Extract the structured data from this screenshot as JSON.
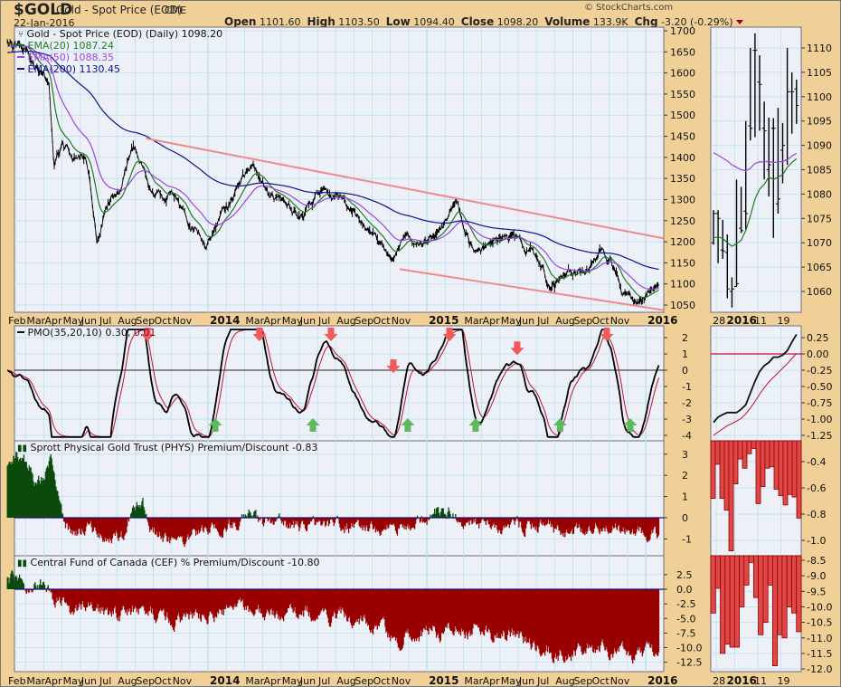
{
  "header": {
    "symbol": "$GOLD",
    "name": "Gold - Spot Price (EOD)",
    "exchange": "CME",
    "date": "22-Jan-2016",
    "copyright": "© StockCharts.com",
    "open_label": "Open",
    "open": "1101.60",
    "high_label": "High",
    "high": "1103.50",
    "low_label": "Low",
    "low": "1094.40",
    "close_label": "Close",
    "close": "1098.20",
    "volume_label": "Volume",
    "volume": "133.9K",
    "chg_label": "Chg",
    "chg": "-3.20 (-0.29%)"
  },
  "legends": {
    "price": "Gold - Spot Price (EOD) (Daily) 1098.20",
    "ema20": "EMA(20) 1087.24",
    "ema50": "EMA(50) 1088.35",
    "ema200": "EMA(200) 1130.45",
    "pmo_main": "PMO(35,20,10) 0.30,",
    "pmo_signal": "0.01",
    "phys": "Sprott Physical Gold Trust (PHYS) Premium/Discount -0.83",
    "cef": "Central Fund of Canada (CEF) % Premium/Discount -10.80"
  },
  "colors": {
    "background": "#f0d096",
    "panel": "#eef0f8",
    "grid": "#b9e2ee",
    "ema20": "#1f7a1f",
    "ema50": "#9b45e6",
    "ema200": "#10108c",
    "trendline": "#f08a8a",
    "pmo_signal": "#c0103a",
    "positive_bar": "#0b4a0b",
    "negative_bar": "#990000",
    "mini_bar": "#e04848",
    "arrow_down": "#f05a5a",
    "arrow_up": "#5cba5c"
  },
  "chart_data": [
    {
      "type": "line",
      "title": "Gold - Spot Price (EOD) (Daily)",
      "x_unit": "month index (Jan 2013 = 0)",
      "xlim": [
        0.95,
        36.75
      ],
      "ylim": [
        1040,
        1710
      ],
      "y_ticks": [
        1700,
        1650,
        1600,
        1550,
        1500,
        1450,
        1400,
        1350,
        1300,
        1250,
        1200,
        1150,
        1100,
        1050
      ],
      "price_keypoints": [
        [
          1.0,
          1670
        ],
        [
          2.0,
          1640
        ],
        [
          3.0,
          1600
        ],
        [
          3.3,
          1560
        ],
        [
          3.55,
          1380
        ],
        [
          4.0,
          1440
        ],
        [
          4.6,
          1400
        ],
        [
          5.3,
          1390
        ],
        [
          5.9,
          1200
        ],
        [
          6.5,
          1290
        ],
        [
          7.2,
          1330
        ],
        [
          7.9,
          1410
        ],
        [
          8.4,
          1390
        ],
        [
          8.8,
          1320
        ],
        [
          9.5,
          1300
        ],
        [
          10.3,
          1310
        ],
        [
          11.0,
          1250
        ],
        [
          11.9,
          1200
        ],
        [
          12.6,
          1250
        ],
        [
          13.5,
          1320
        ],
        [
          14.5,
          1380
        ],
        [
          15.3,
          1300
        ],
        [
          16.4,
          1295
        ],
        [
          17.2,
          1250
        ],
        [
          18.3,
          1330
        ],
        [
          19.3,
          1310
        ],
        [
          20.3,
          1250
        ],
        [
          21.1,
          1220
        ],
        [
          22.1,
          1150
        ],
        [
          22.8,
          1200
        ],
        [
          23.7,
          1195
        ],
        [
          24.5,
          1200
        ],
        [
          25.7,
          1295
        ],
        [
          26.6,
          1165
        ],
        [
          27.5,
          1200
        ],
        [
          28.7,
          1210
        ],
        [
          29.7,
          1175
        ],
        [
          30.4,
          1130
        ],
        [
          30.8,
          1090
        ],
        [
          31.6,
          1120
        ],
        [
          32.2,
          1130
        ],
        [
          33.0,
          1140
        ],
        [
          33.6,
          1180
        ],
        [
          34.1,
          1150
        ],
        [
          34.7,
          1080
        ],
        [
          35.6,
          1060
        ],
        [
          36.0,
          1065
        ],
        [
          36.72,
          1098.2
        ]
      ],
      "last_values": {
        "close": 1098.2,
        "ema20": 1087.24,
        "ema50": 1088.35,
        "ema200": 1130.45
      },
      "trendlines": [
        {
          "name": "upper",
          "from": [
            8.6,
            1445
          ],
          "to": [
            37.0,
            1208
          ]
        },
        {
          "name": "lower",
          "from": [
            22.5,
            1135
          ],
          "to": [
            37.0,
            1038
          ]
        }
      ],
      "x_labels": [
        {
          "m": 1,
          "label": "Feb"
        },
        {
          "m": 2,
          "label": "Mar"
        },
        {
          "m": 3,
          "label": "Apr"
        },
        {
          "m": 4,
          "label": "May"
        },
        {
          "m": 5,
          "label": "Jun"
        },
        {
          "m": 6,
          "label": "Jul"
        },
        {
          "m": 7,
          "label": "Aug"
        },
        {
          "m": 8,
          "label": "Sep"
        },
        {
          "m": 9,
          "label": "Oct"
        },
        {
          "m": 10,
          "label": "Nov"
        },
        {
          "m": 12,
          "label": "2014",
          "bold": true
        },
        {
          "m": 14,
          "label": "Mar"
        },
        {
          "m": 15,
          "label": "Apr"
        },
        {
          "m": 16,
          "label": "May"
        },
        {
          "m": 17,
          "label": "Jun"
        },
        {
          "m": 18,
          "label": "Jul"
        },
        {
          "m": 19,
          "label": "Aug"
        },
        {
          "m": 20,
          "label": "Sep"
        },
        {
          "m": 21,
          "label": "Oct"
        },
        {
          "m": 22,
          "label": "Nov"
        },
        {
          "m": 24,
          "label": "2015",
          "bold": true
        },
        {
          "m": 26,
          "label": "Mar"
        },
        {
          "m": 27,
          "label": "Apr"
        },
        {
          "m": 28,
          "label": "May"
        },
        {
          "m": 29,
          "label": "Jun"
        },
        {
          "m": 30,
          "label": "Jul"
        },
        {
          "m": 31,
          "label": "Aug"
        },
        {
          "m": 32,
          "label": "Sep"
        },
        {
          "m": 33,
          "label": "Oct"
        },
        {
          "m": 34,
          "label": "Nov"
        },
        {
          "m": 36,
          "label": "2016",
          "bold": true
        }
      ]
    },
    {
      "type": "line",
      "title": "PMO(35,20,10)",
      "ylim": [
        -4.2,
        2.6
      ],
      "y_ticks": [
        2,
        1,
        0,
        -1,
        -2,
        -3,
        -4
      ],
      "last_values": {
        "pmo": 0.3,
        "signal": 0.01
      },
      "arrows": [
        {
          "m": 8.68,
          "dir": "down"
        },
        {
          "m": 14.82,
          "dir": "down"
        },
        {
          "m": 18.74,
          "dir": "down"
        },
        {
          "m": 22.16,
          "dir": "down"
        },
        {
          "m": 25.24,
          "dir": "down"
        },
        {
          "m": 28.95,
          "dir": "down"
        },
        {
          "m": 33.86,
          "dir": "down"
        },
        {
          "m": 12.4,
          "dir": "up"
        },
        {
          "m": 17.75,
          "dir": "up"
        },
        {
          "m": 22.95,
          "dir": "up"
        },
        {
          "m": 26.67,
          "dir": "up"
        },
        {
          "m": 31.3,
          "dir": "up"
        },
        {
          "m": 35.15,
          "dir": "up"
        }
      ]
    },
    {
      "type": "bar",
      "title": "Sprott Physical Gold Trust (PHYS) Premium/Discount",
      "ylim": [
        -1.8,
        3.6
      ],
      "y_ticks": [
        3,
        2,
        1,
        0,
        -1
      ],
      "keypoints": [
        [
          1.0,
          2.5
        ],
        [
          1.5,
          3.2
        ],
        [
          2.2,
          2.4
        ],
        [
          2.6,
          1.5
        ],
        [
          3.0,
          2.0
        ],
        [
          3.4,
          2.6
        ],
        [
          3.8,
          1.0
        ],
        [
          4.1,
          -0.2
        ],
        [
          4.6,
          -0.6
        ],
        [
          5.5,
          -0.5
        ],
        [
          6.5,
          -1.0
        ],
        [
          7.3,
          -0.8
        ],
        [
          7.9,
          0.2
        ],
        [
          8.4,
          0.7
        ],
        [
          8.8,
          -0.3
        ],
        [
          9.5,
          -1.0
        ],
        [
          10.5,
          -1.2
        ],
        [
          11.5,
          -0.7
        ],
        [
          12.5,
          -0.5
        ],
        [
          13.5,
          -0.3
        ],
        [
          14.2,
          0.1
        ],
        [
          14.8,
          -0.2
        ],
        [
          16,
          -0.3
        ],
        [
          17,
          -0.5
        ],
        [
          18,
          -0.2
        ],
        [
          19,
          -0.3
        ],
        [
          20,
          -0.4
        ],
        [
          21,
          -0.5
        ],
        [
          22,
          -0.6
        ],
        [
          23,
          -0.3
        ],
        [
          23.8,
          -0.2
        ],
        [
          24.6,
          0.3
        ],
        [
          25.3,
          0.4
        ],
        [
          25.7,
          -0.1
        ],
        [
          26.5,
          -0.3
        ],
        [
          27.5,
          -0.4
        ],
        [
          28.5,
          -0.3
        ],
        [
          29.5,
          -0.4
        ],
        [
          30.5,
          -0.5
        ],
        [
          31.5,
          -0.6
        ],
        [
          32.5,
          -0.5
        ],
        [
          33.5,
          -0.4
        ],
        [
          34.5,
          -0.6
        ],
        [
          35.5,
          -0.6
        ],
        [
          36.72,
          -0.83
        ]
      ],
      "last_value": -0.83
    },
    {
      "type": "bar",
      "title": "Central Fund of Canada (CEF) % Premium/Discount",
      "ylim": [
        -13.5,
        5.5
      ],
      "y_ticks": [
        2.5,
        0.0,
        -2.5,
        -5.0,
        -7.5,
        -10.0,
        -12.5
      ],
      "keypoints": [
        [
          1.0,
          1.5
        ],
        [
          1.6,
          1.0
        ],
        [
          2.2,
          0.8
        ],
        [
          2.8,
          0.6
        ],
        [
          3.3,
          0.3
        ],
        [
          3.6,
          -1.5
        ],
        [
          4.5,
          -3.5
        ],
        [
          5.5,
          -3.0
        ],
        [
          6.5,
          -4.5
        ],
        [
          7.5,
          -4.0
        ],
        [
          8.5,
          -3.5
        ],
        [
          9.5,
          -5.0
        ],
        [
          10.5,
          -5.5
        ],
        [
          11.5,
          -4.5
        ],
        [
          12.5,
          -4.5
        ],
        [
          13.5,
          -3.5
        ],
        [
          14.5,
          -3.5
        ],
        [
          15.5,
          -4.5
        ],
        [
          16.5,
          -4.5
        ],
        [
          17.5,
          -4.0
        ],
        [
          18.5,
          -4.5
        ],
        [
          19.5,
          -5.0
        ],
        [
          20.5,
          -5.5
        ],
        [
          21.5,
          -7.0
        ],
        [
          22.5,
          -8.5
        ],
        [
          23.5,
          -8.0
        ],
        [
          24.2,
          -6.5
        ],
        [
          24.7,
          -8.0
        ],
        [
          25.5,
          -6.0
        ],
        [
          26.5,
          -7.0
        ],
        [
          27.5,
          -8.0
        ],
        [
          28.5,
          -8.0
        ],
        [
          29.5,
          -9.0
        ],
        [
          30.3,
          -10.0
        ],
        [
          31,
          -11.0
        ],
        [
          32,
          -10.5
        ],
        [
          33,
          -10.0
        ],
        [
          34,
          -10.5
        ],
        [
          35,
          -11.0
        ],
        [
          36,
          -10.8
        ],
        [
          36.72,
          -10.8
        ]
      ],
      "last_value": -10.8
    },
    {
      "type": "line",
      "title": "Gold mini (daily OHLC, 24-Dec-2015 to 22-Jan-2016)",
      "ylim": [
        1055,
        1114
      ],
      "y_ticks": [
        1110,
        1105,
        1100,
        1095,
        1090,
        1085,
        1080,
        1075,
        1070,
        1065,
        1060
      ],
      "x_labels": [
        {
          "i": 1,
          "label": "28"
        },
        {
          "i": 5,
          "label": "2016",
          "bold": true
        },
        {
          "i": 10,
          "label": "11"
        },
        {
          "i": 15,
          "label": "19"
        }
      ],
      "bars": [
        {
          "o": 1070,
          "h": 1076.7,
          "l": 1069.6,
          "c": 1076
        },
        {
          "o": 1076,
          "h": 1076.7,
          "l": 1065.8,
          "c": 1075
        },
        {
          "o": 1068.5,
          "h": 1074.7,
          "l": 1066.7,
          "c": 1068.3
        },
        {
          "o": 1068,
          "h": 1071.7,
          "l": 1058.6,
          "c": 1060.5
        },
        {
          "o": 1060,
          "h": 1062.9,
          "l": 1056.7,
          "c": 1060.5
        },
        {
          "o": 1061,
          "h": 1083,
          "l": 1061,
          "c": 1061.6
        },
        {
          "o": 1073,
          "h": 1081.5,
          "l": 1072,
          "c": 1072.5
        },
        {
          "o": 1076.5,
          "h": 1095,
          "l": 1072.7,
          "c": 1076
        },
        {
          "o": 1094,
          "h": 1110,
          "l": 1091,
          "c": 1093.5
        },
        {
          "o": 1109.5,
          "h": 1113,
          "l": 1091.7,
          "c": 1109.5
        },
        {
          "o": 1103,
          "h": 1108.5,
          "l": 1093,
          "c": 1102.5
        },
        {
          "o": 1093.5,
          "h": 1099,
          "l": 1083,
          "c": 1093
        },
        {
          "o": 1085,
          "h": 1095.7,
          "l": 1079.5,
          "c": 1086
        },
        {
          "o": 1093.5,
          "h": 1095.6,
          "l": 1071,
          "c": 1093.5
        },
        {
          "o": 1078,
          "h": 1097.7,
          "l": 1076,
          "c": 1079
        },
        {
          "o": 1089,
          "h": 1094.6,
          "l": 1082.2,
          "c": 1090
        },
        {
          "o": 1087,
          "h": 1110,
          "l": 1086,
          "c": 1101
        },
        {
          "o": 1101,
          "h": 1105,
          "l": 1092.4,
          "c": 1101
        },
        {
          "o": 1101.6,
          "h": 1103.5,
          "l": 1094.4,
          "c": 1098.2
        }
      ],
      "ema20": [
        1071,
        1071.2,
        1070.9,
        1070,
        1069.3,
        1069.8,
        1070.5,
        1072.5,
        1075.5,
        1079,
        1081,
        1082,
        1083.5,
        1083,
        1083.5,
        1084,
        1085.5,
        1086.5,
        1087.24
      ],
      "ema50": [
        1088.5,
        1088,
        1087.4,
        1086.8,
        1086,
        1085.5,
        1085,
        1084.8,
        1085.3,
        1086.3,
        1086.6,
        1086.6,
        1086.7,
        1086.5,
        1086.6,
        1086.7,
        1087,
        1087.8,
        1088.35
      ]
    },
    {
      "type": "line",
      "title": "PMO mini",
      "ylim": [
        -1.3,
        0.35
      ],
      "y_ticks": [
        0.25,
        0.0,
        -0.25,
        -0.5,
        -0.75,
        -1.0,
        -1.25
      ],
      "pmo": [
        -1.05,
        -0.97,
        -0.93,
        -0.9,
        -0.9,
        -0.9,
        -0.85,
        -0.78,
        -0.6,
        -0.42,
        -0.27,
        -0.18,
        -0.13,
        -0.05,
        -0.05,
        -0.02,
        0.05,
        0.18,
        0.3
      ],
      "signal": [
        -1.25,
        -1.2,
        -1.15,
        -1.1,
        -1.07,
        -1.03,
        -0.99,
        -0.92,
        -0.83,
        -0.73,
        -0.62,
        -0.52,
        -0.43,
        -0.36,
        -0.29,
        -0.22,
        -0.15,
        -0.07,
        0.01
      ]
    },
    {
      "type": "bar",
      "title": "PHYS mini",
      "ylim": [
        -1.15,
        -0.25
      ],
      "y_ticks": [
        -0.4,
        -0.6,
        -0.8,
        -1.0
      ],
      "values": [
        -0.68,
        -0.42,
        -0.68,
        -0.77,
        -1.08,
        -0.57,
        -0.38,
        -0.45,
        -0.34,
        -0.3,
        -0.72,
        -0.59,
        -0.45,
        -0.44,
        -0.61,
        -0.66,
        -0.73,
        -0.65,
        -0.67,
        -0.83
      ]
    },
    {
      "type": "bar",
      "title": "CEF mini",
      "ylim": [
        -12.1,
        -8.38
      ],
      "y_ticks": [
        -8.5,
        -9.0,
        -9.5,
        -10.0,
        -10.5,
        -11.0,
        -11.5,
        -12.0
      ],
      "values": [
        -10.2,
        -9.4,
        -11.5,
        -11.2,
        -11.3,
        -11.3,
        -10.0,
        -9.3,
        -8.57,
        -9.7,
        -10.9,
        -10.5,
        -9.3,
        -11.9,
        -10.9,
        -11.0,
        -10.0,
        -10.2,
        -10.8
      ]
    }
  ]
}
